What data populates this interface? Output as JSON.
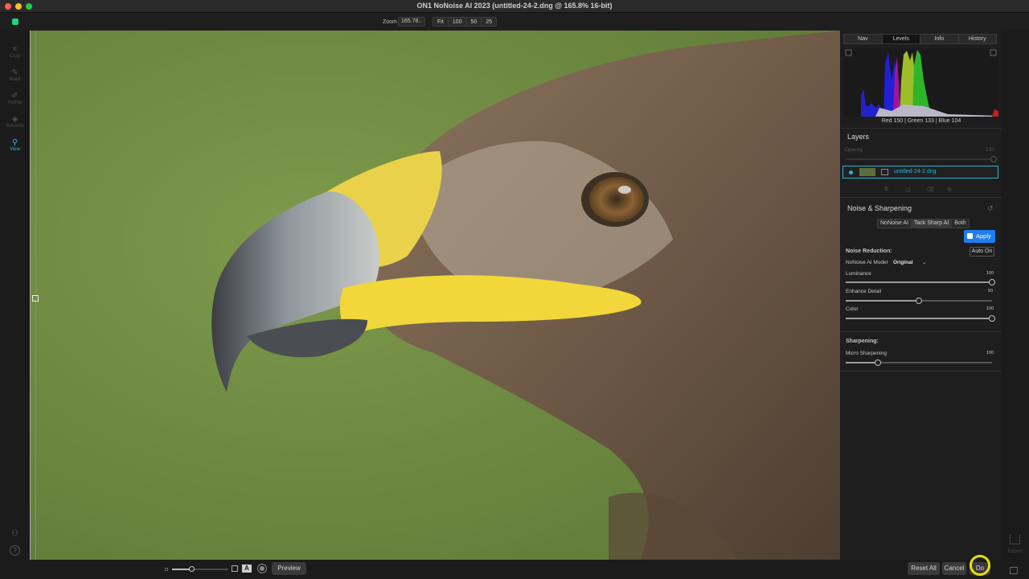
{
  "window": {
    "title": "ON1 NoNoise AI 2023 (untitled-24-2.dng @ 165.8% 16-bit)"
  },
  "toolbar": {
    "zoom_label": "Zoom",
    "zoom_value": "165.78",
    "zoom_presets": [
      "Fit",
      "100",
      "50",
      "25"
    ]
  },
  "tools": [
    {
      "label": "Crop",
      "icon": "crop-icon",
      "glyph": "⌗",
      "active": false
    },
    {
      "label": "Mask",
      "icon": "mask-brush-icon",
      "glyph": "✎",
      "active": false
    },
    {
      "label": "Refine",
      "icon": "refine-brush-icon",
      "glyph": "✐",
      "active": false
    },
    {
      "label": "Retouch",
      "icon": "retouch-icon",
      "glyph": "◈",
      "active": false
    },
    {
      "label": "View",
      "icon": "zoom-view-icon",
      "glyph": "⚲",
      "active": true
    }
  ],
  "right_panel": {
    "tabs": [
      "Nav",
      "Levels",
      "Info",
      "History"
    ],
    "active_tab": "Levels",
    "histogram_readout": "Red 150 | Green 133 | Blue 104",
    "layers": {
      "title": "Layers",
      "opacity_label": "Opacity",
      "opacity_value": "100",
      "layer_name": "untitled-24-2.dng"
    },
    "noise": {
      "title": "Noise & Sharpening",
      "modes": [
        "NoNoise AI",
        "Tack Sharp AI",
        "Both"
      ],
      "active_mode": "Tack Sharp AI",
      "apply_label": "Apply",
      "noise_reduction_label": "Noise Reduction:",
      "auto_label": "Auto On",
      "model_label": "NoNoise AI Model",
      "model_value": "Original",
      "sliders": [
        {
          "label": "Luminance",
          "value": "100",
          "level": 1.0
        },
        {
          "label": "Enhance Detail",
          "value": "50",
          "level": 0.5
        },
        {
          "label": "Color",
          "value": "100",
          "level": 1.0
        }
      ],
      "sharpening_label": "Sharpening:",
      "micro_label": "Micro Sharpening",
      "micro_value": "100",
      "micro_level": 0.22
    }
  },
  "export_label": "Export",
  "bottom": {
    "preview_label": "Preview",
    "reset_all_label": "Reset All",
    "cancel_label": "Cancel",
    "done_label": "Do"
  },
  "colors": {
    "accent": "#2ab7d6",
    "apply_blue": "#1f7df0",
    "background_green": "#6e8a40"
  }
}
